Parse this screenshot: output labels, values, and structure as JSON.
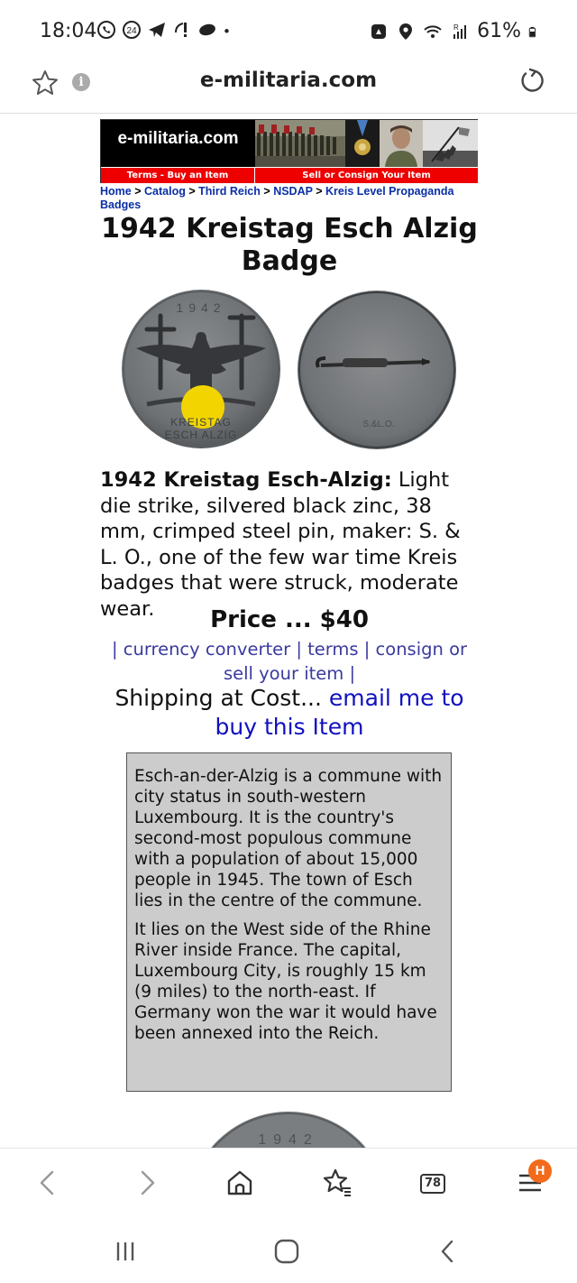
{
  "status_bar": {
    "time": "18:04",
    "battery": "61%",
    "icons": [
      "whatsapp-icon",
      "calendar-24-icon",
      "telegram-icon",
      "alert-icon",
      "cloud-icon",
      "dot-icon",
      "recycle-icon",
      "location-icon",
      "wifi-icon",
      "signal-icon",
      "battery-icon"
    ],
    "calendar_badge": "24",
    "signal_label": "R"
  },
  "browser": {
    "url": "e-militaria.com",
    "info_label": "i"
  },
  "banner": {
    "logo": "e-militaria.com",
    "tab_left": "Terms - Buy an Item",
    "tab_right": "Sell or Consign Your Item"
  },
  "breadcrumb": {
    "items": [
      "Home",
      "Catalog",
      "Third Reich",
      "NSDAP",
      "Kreis Level Propaganda Badges"
    ],
    "separator": ">"
  },
  "product": {
    "title": "1942 Kreistag Esch Alzig Badge",
    "badge_year": "1942",
    "badge_text_line1": "KREISTAG",
    "badge_text_line2": "ESCH ALZIG",
    "maker_mark": "S.&L.O.",
    "desc_bold": "1942 Kreistag Esch-Alzig:",
    "desc_text": " Light die strike, silvered black zinc, 38 mm, crimped steel pin, maker: S. & L. O., one of the few war time Kreis badges that were struck, moderate wear.",
    "price": "Price ... $40",
    "link_sep_open": "| ",
    "link_currency": "currency converter",
    "link_sep1": " | ",
    "link_terms": "terms",
    "link_sep2": " | ",
    "link_consign": "consign or sell your item",
    "link_sep_close": " |",
    "shipping_text": "Shipping at Cost... ",
    "shipping_link": "email me to buy this Item"
  },
  "info_box": {
    "para1": "Esch-an-der-Alzig is a commune with city status in south-western Luxembourg. It is the country's second-most populous commune with a population of about 15,000 people in 1945. The town of Esch lies in the centre of the commune.",
    "para2": "It lies on the West side of the Rhine River inside France. The capital, Luxembourg City, is roughly 15 km (9 miles) to the north-east. If Germany won the war it would have been annexed into the Reich."
  },
  "toolbar": {
    "tabs_count": "78",
    "notification_letter": "H"
  }
}
